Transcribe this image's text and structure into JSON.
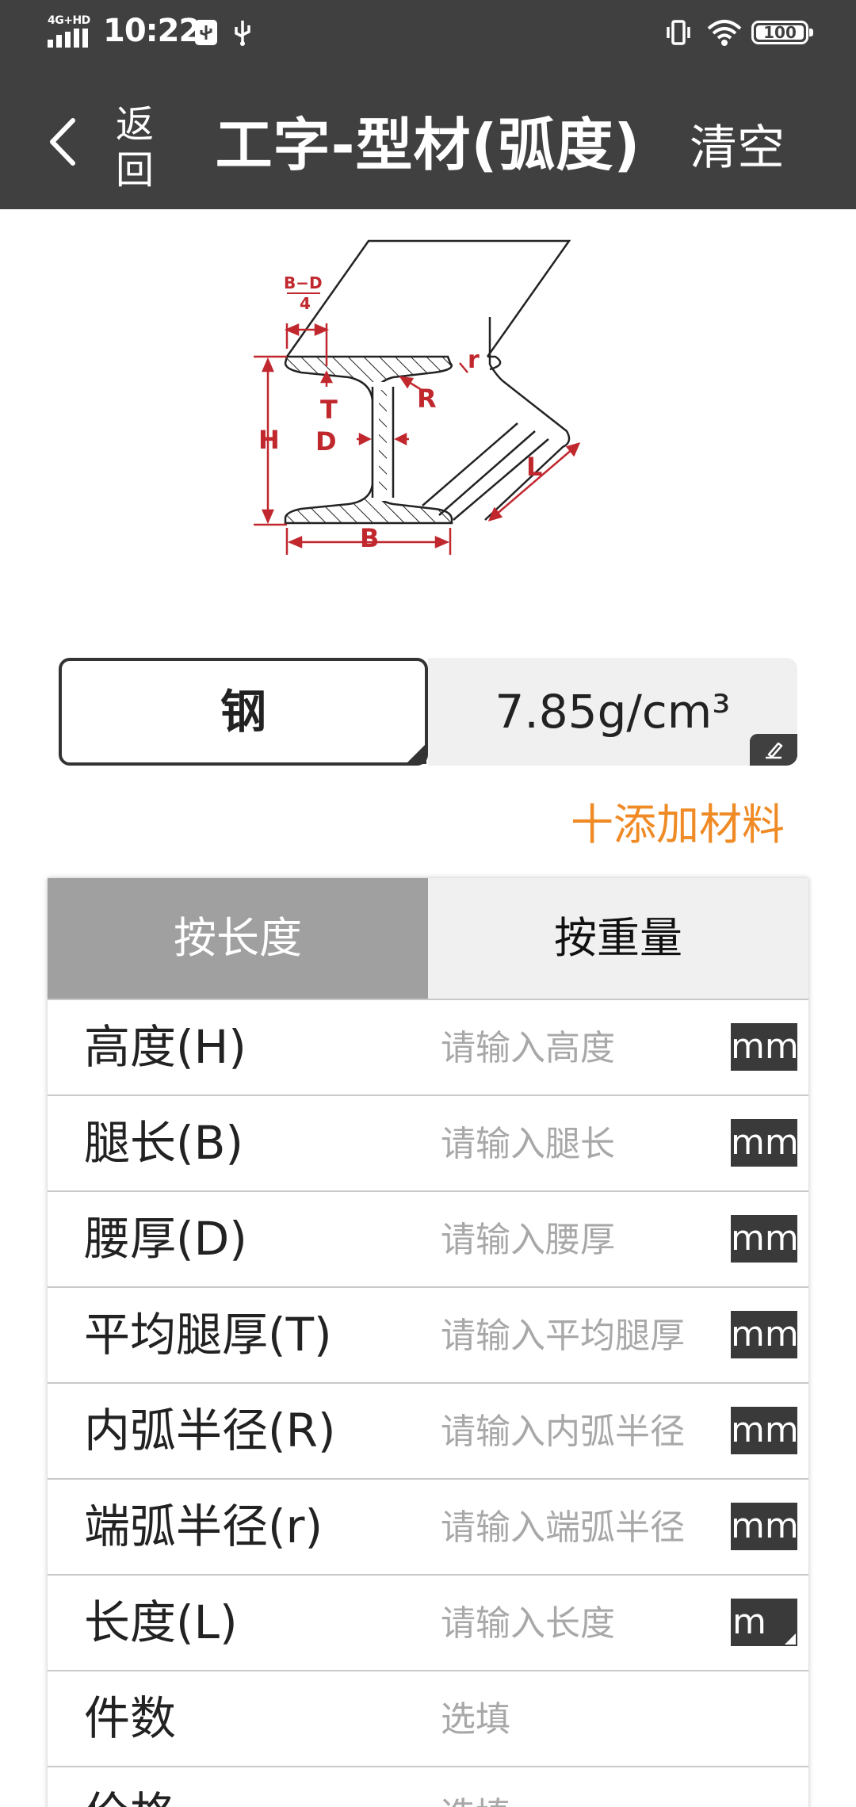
{
  "status": {
    "network": "4G+HD",
    "time": "10:22",
    "battery": "100"
  },
  "appbar": {
    "back_label": "返回",
    "title": "工字-型材(弧度)",
    "clear_label": "清空"
  },
  "diagram": {
    "labels": {
      "bd": "B−D",
      "four": "4",
      "r_small": "r",
      "R": "R",
      "T": "T",
      "H": "H",
      "D": "D",
      "L": "L",
      "B": "B"
    }
  },
  "material": {
    "name": "钢",
    "density": "7.85g/cm³"
  },
  "add_material": "十添加材料",
  "tabs": {
    "by_length": "按长度",
    "by_weight": "按重量"
  },
  "rows": [
    {
      "label": "高度(H)",
      "placeholder": "请输入高度",
      "unit": "mm"
    },
    {
      "label": "腿长(B)",
      "placeholder": "请输入腿长",
      "unit": "mm"
    },
    {
      "label": "腰厚(D)",
      "placeholder": "请输入腰厚",
      "unit": "mm"
    },
    {
      "label": "平均腿厚(T)",
      "placeholder": "请输入平均腿厚",
      "unit": "mm"
    },
    {
      "label": "内弧半径(R)",
      "placeholder": "请输入内弧半径",
      "unit": "mm"
    },
    {
      "label": "端弧半径(r)",
      "placeholder": "请输入端弧半径",
      "unit": "mm"
    },
    {
      "label": "长度(L)",
      "placeholder": "请输入长度",
      "unit": "m"
    },
    {
      "label": "件数",
      "placeholder": "选填",
      "unit": ""
    },
    {
      "label": "价格",
      "placeholder": "选填",
      "unit": ""
    }
  ],
  "colors": {
    "header_bg": "#404040",
    "accent": "#ef8a25",
    "diagram_red": "#c0282e",
    "tab_active": "#a0a0a0",
    "tab_inactive": "#f0f0f0"
  }
}
